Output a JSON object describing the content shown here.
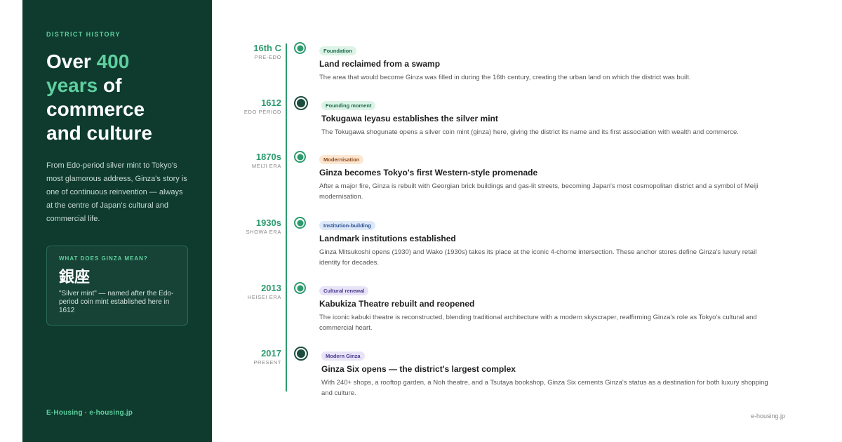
{
  "sidebar": {
    "eyebrow": "DISTRICT HISTORY",
    "headline": {
      "part1": "Over ",
      "accent1": "400",
      "accent2": "years",
      "part2": " of",
      "line3": "commerce",
      "line4": "and culture"
    },
    "intro": "From Edo-period silver mint to Tokyo's most glamorous address, Ginza's story is one of continuous reinvention — always at the centre of Japan's cultural and commercial life.",
    "meaning": {
      "label": "WHAT DOES GINZA MEAN?",
      "kanji": "銀座",
      "text": "\"Silver mint\" — named after the Edo-period coin mint established here in 1612"
    },
    "footer": "E-Housing · e-housing.jp"
  },
  "colors": {
    "sidebar_bg": "#0e3b2e",
    "accent_green": "#5fcf9f",
    "timeline_green": "#2e9b6f"
  },
  "timeline": {
    "entries": [
      {
        "year": "16th C",
        "era": "PRE-EDO",
        "tag": "Foundation",
        "tag_bg": "#dcf3e7",
        "tag_color": "#1e6b4a",
        "title": "Land reclaimed from a swamp",
        "desc": "The area that would become Ginza was filled in during the 16th century, creating the urban land on which the district was built.",
        "marker": "small"
      },
      {
        "year": "1612",
        "era": "EDO PERIOD",
        "tag": "Founding moment",
        "tag_bg": "#dcf3e7",
        "tag_color": "#1e6b4a",
        "title": "Tokugawa Ieyasu establishes the silver mint",
        "desc": "The Tokugawa shogunate opens a silver coin mint (ginza) here, giving the district its name and its first association with wealth and commerce.",
        "marker": "big"
      },
      {
        "year": "1870s",
        "era": "MEIJI ERA",
        "tag": "Modernisation",
        "tag_bg": "#fde6d2",
        "tag_color": "#8a4a1b",
        "title": "Ginza becomes Tokyo's first Western-style promenade",
        "desc": "After a major fire, Ginza is rebuilt with Georgian brick buildings and gas-lit streets, becoming Japan's most cosmopolitan district and a symbol of Meiji modernisation.",
        "marker": "small"
      },
      {
        "year": "1930s",
        "era": "SHOWA ERA",
        "tag": "Institution-building",
        "tag_bg": "#dde8f9",
        "tag_color": "#2b4f8c",
        "title": "Landmark institutions established",
        "desc": "Ginza Mitsukoshi opens (1930) and Wako (1930s) takes its place at the iconic 4-chome intersection. These anchor stores define Ginza's luxury retail identity for decades.",
        "marker": "small"
      },
      {
        "year": "2013",
        "era": "HEISEI ERA",
        "tag": "Cultural renewal",
        "tag_bg": "#e8e3f7",
        "tag_color": "#4a3a8c",
        "title": "Kabukiza Theatre rebuilt and reopened",
        "desc": "The iconic kabuki theatre is reconstructed, blending traditional architecture with a modern skyscraper, reaffirming Ginza's role as Tokyo's cultural and commercial heart.",
        "marker": "small"
      },
      {
        "year": "2017",
        "era": "PRESENT",
        "tag": "Modern Ginza",
        "tag_bg": "#e8e3f7",
        "tag_color": "#4a3a8c",
        "title": "Ginza Six opens — the district's largest complex",
        "desc": "With 240+ shops, a rooftop garden, a Noh theatre, and a Tsutaya bookshop, Ginza Six cements Ginza's status as a destination for both luxury shopping and culture.",
        "marker": "big"
      }
    ]
  },
  "footer": {
    "site": "e-housing.jp"
  }
}
